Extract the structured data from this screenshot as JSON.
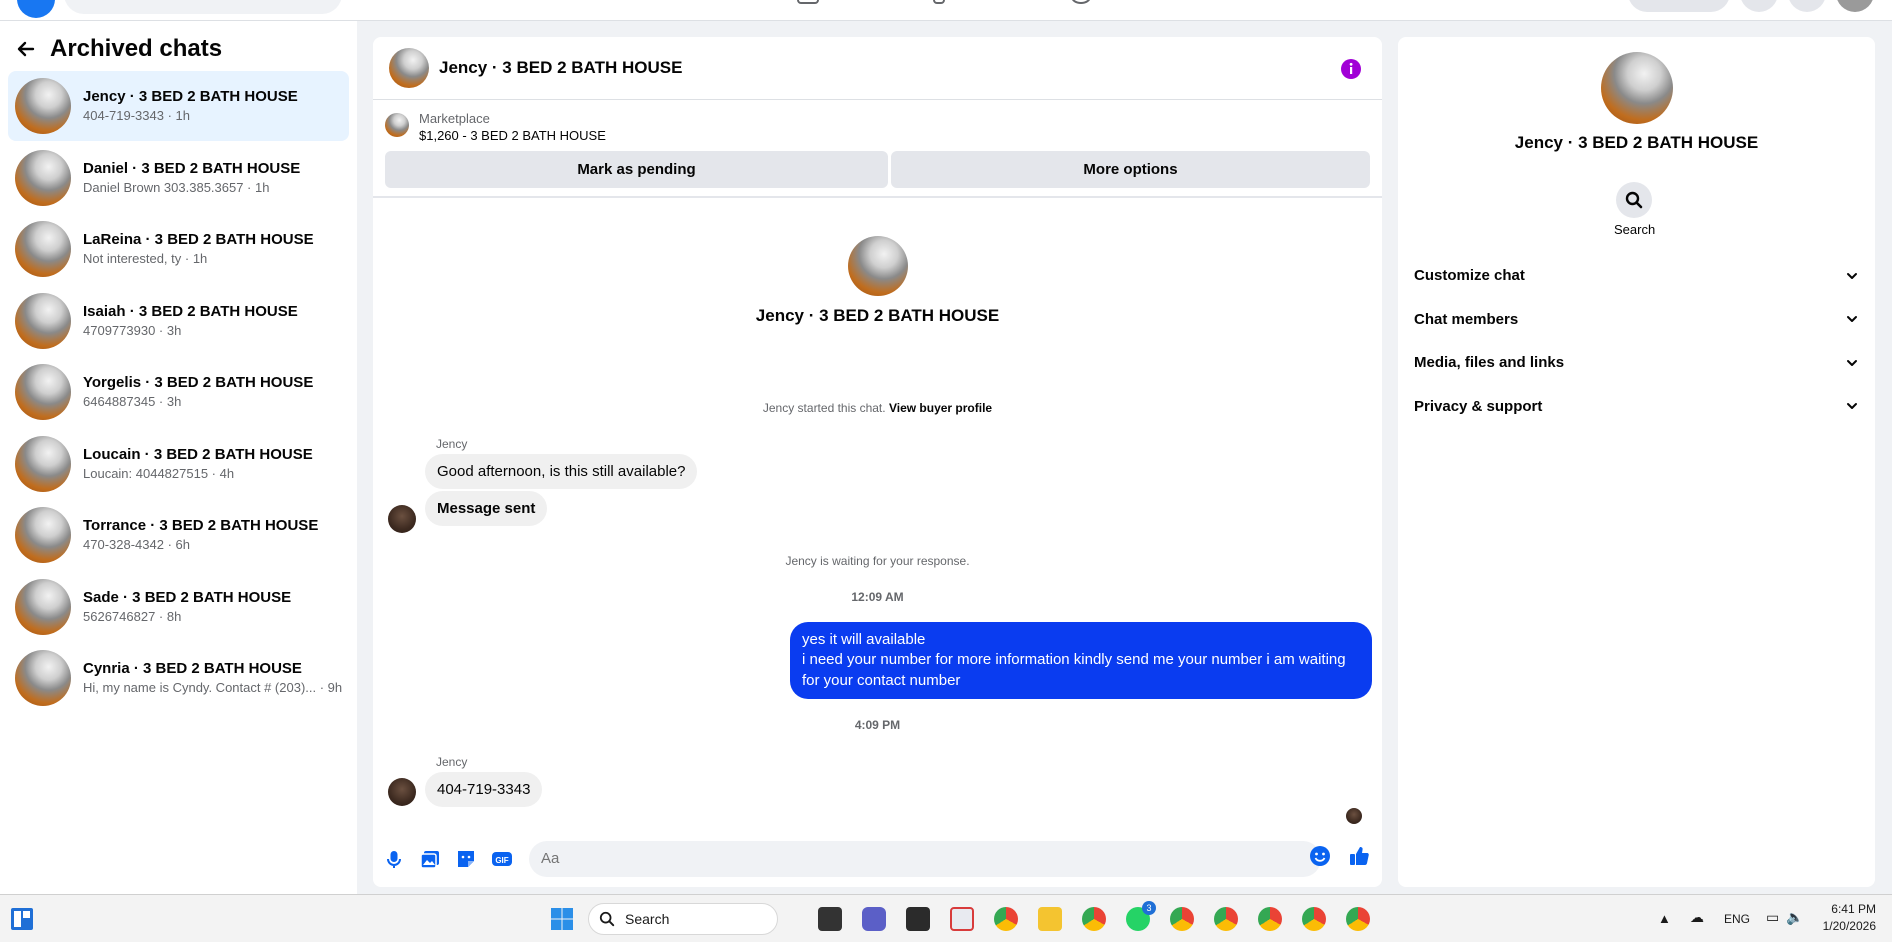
{
  "colors": {
    "accent": "#0a3cf0",
    "brand": "#1877f2",
    "info": "#a100d6",
    "active_bg": "#e7f3ff"
  },
  "sidebar": {
    "title": "Archived chats",
    "back_icon": "arrow-left-icon",
    "items": [
      {
        "name": "Jency · 3 BED 2 BATH HOUSE",
        "sub": "404-719-3343 · 1h",
        "active": true
      },
      {
        "name": "Daniel · 3 BED 2 BATH HOUSE",
        "sub": "Daniel Brown 303.385.3657 · 1h"
      },
      {
        "name": "LaReina · 3 BED 2 BATH HOUSE",
        "sub": "Not interested, ty · 1h"
      },
      {
        "name": "Isaiah · 3 BED 2 BATH HOUSE",
        "sub": "4709773930 · 3h"
      },
      {
        "name": "Yorgelis · 3 BED 2 BATH HOUSE",
        "sub": "6464887345 · 3h"
      },
      {
        "name": "Loucain · 3 BED 2 BATH HOUSE",
        "sub": "Loucain: 4044827515 · 4h"
      },
      {
        "name": "Torrance · 3 BED 2 BATH HOUSE",
        "sub": "470-328-4342 · 6h"
      },
      {
        "name": "Sade · 3 BED 2 BATH HOUSE",
        "sub": "5626746827 · 8h"
      },
      {
        "name": "Cynria · 3 BED 2 BATH HOUSE",
        "sub": "Hi, my name is Cyndy. Contact # (203)... · 9h"
      }
    ]
  },
  "chat": {
    "title": "Jency · 3 BED 2 BATH HOUSE",
    "listing_source": "Marketplace",
    "listing_title": "$1,260 - 3 BED 2 BATH HOUSE",
    "btn_pending": "Mark as pending",
    "btn_more": "More options",
    "profile_name": "Jency · 3 BED 2 BATH HOUSE",
    "started_text": "Jency started this chat.",
    "view_profile": "View buyer profile",
    "sender1": "Jency",
    "msg1": "Good afternoon, is this still available?",
    "msg2": "Message sent",
    "waiting": "Jency is waiting for your response.",
    "time1": "12:09 AM",
    "out_msg": "yes it will available\n i need your number for more information kindly send me your number i am waiting for your contact number",
    "time2": "4:09 PM",
    "sender2": "Jency",
    "msg3": "404-719-3343",
    "composer_placeholder": "Aa"
  },
  "details": {
    "name": "Jency · 3 BED 2 BATH HOUSE",
    "search_label": "Search",
    "sections": [
      "Customize chat",
      "Chat members",
      "Media, files and links",
      "Privacy & support"
    ]
  },
  "taskbar": {
    "search_label": "Search",
    "lang": "ENG",
    "time": "6:41 PM",
    "date": "1/20/2026",
    "whatsapp_badge": "3"
  }
}
